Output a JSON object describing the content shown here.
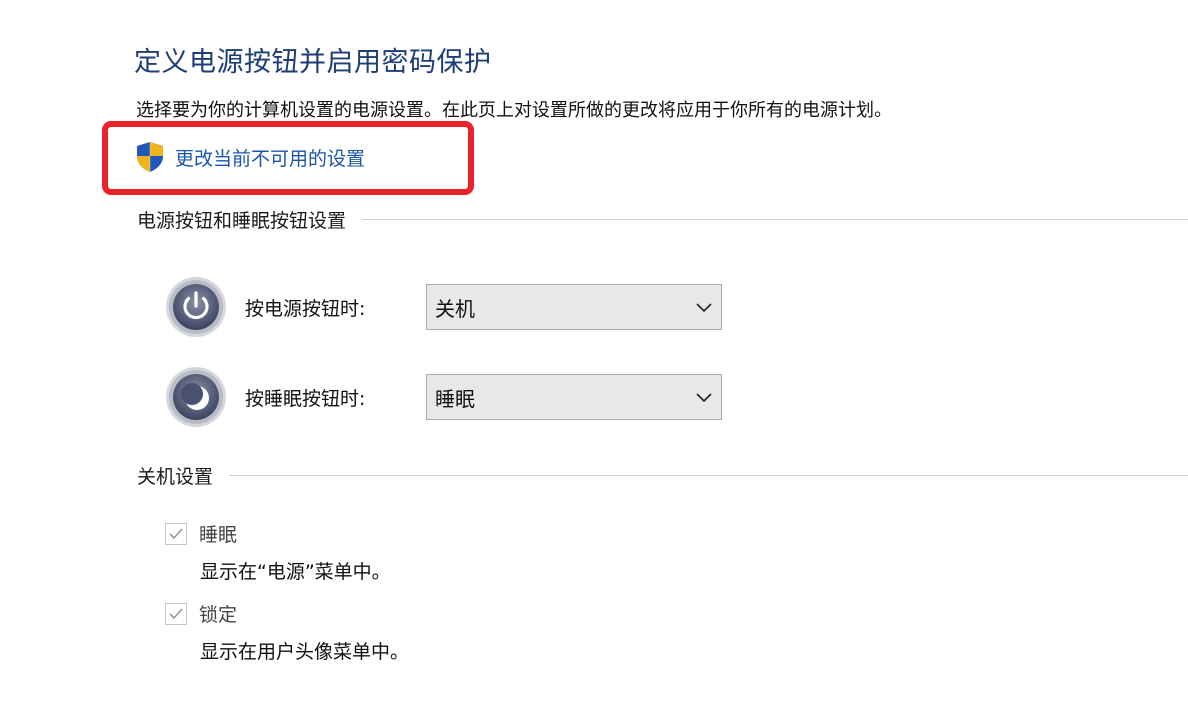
{
  "page_title": "定义电源按钮并启用密码保护",
  "description": "选择要为你的计算机设置的电源设置。在此页上对设置所做的更改将应用于你所有的电源计划。",
  "change_settings_link": {
    "icon": "uac-shield-icon",
    "label": "更改当前不可用的设置"
  },
  "highlight_color": "#e8232a",
  "buttons_section": {
    "header": "电源按钮和睡眠按钮设置",
    "power_button": {
      "icon": "power-icon",
      "label": "按电源按钮时:",
      "selected": "关机"
    },
    "sleep_button": {
      "icon": "sleep-icon",
      "label": "按睡眠按钮时:",
      "selected": "睡眠"
    }
  },
  "shutdown_section": {
    "header": "关机设置",
    "items": [
      {
        "label": "睡眠",
        "description": "显示在“电源”菜单中。",
        "checked": true
      },
      {
        "label": "锁定",
        "description": "显示在用户头像菜单中。",
        "checked": true
      }
    ]
  }
}
